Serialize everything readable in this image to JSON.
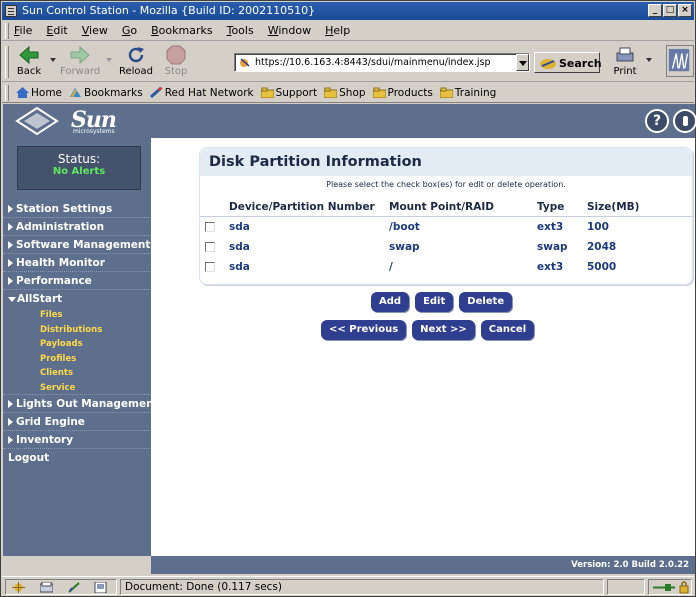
{
  "window": {
    "title": "Sun Control Station - Mozilla {Build ID: 2002110510}"
  },
  "menubar": {
    "items": [
      "File",
      "Edit",
      "View",
      "Go",
      "Bookmarks",
      "Tools",
      "Window",
      "Help"
    ]
  },
  "navbar": {
    "back": "Back",
    "forward": "Forward",
    "reload": "Reload",
    "stop": "Stop",
    "url": "https://10.6.163.4:8443/sdui/mainmenu/index.jsp",
    "search": "Search",
    "print": "Print"
  },
  "personal_toolbar": {
    "items": [
      "Home",
      "Bookmarks",
      "Red Hat Network",
      "Support",
      "Shop",
      "Products",
      "Training"
    ]
  },
  "header": {
    "brand": "Sun",
    "brand_sub": "microsystems",
    "help_label": "?"
  },
  "sidebar": {
    "status_title": "Status:",
    "status_value": "No Alerts",
    "items_top": [
      "Station Settings",
      "Administration",
      "Software Management",
      "Health Monitor",
      "Performance"
    ],
    "allstart_label": "AllStart",
    "allstart_sub": [
      "Files",
      "Distributions",
      "Payloads",
      "Profiles",
      "Clients",
      "Service"
    ],
    "items_bottom": [
      "Lights Out Management",
      "Grid Engine",
      "Inventory"
    ],
    "logout": "Logout"
  },
  "panel": {
    "title": "Disk Partition Information",
    "hint": "Please select the check box(es) for edit or delete operation.",
    "columns": [
      "Device/Partition Number",
      "Mount Point/RAID",
      "Type",
      "Size(MB)"
    ],
    "rows": [
      {
        "device": "sda",
        "mount": "/boot",
        "type": "ext3",
        "size": "100"
      },
      {
        "device": "sda",
        "mount": "swap",
        "type": "swap",
        "size": "2048"
      },
      {
        "device": "sda",
        "mount": "/",
        "type": "ext3",
        "size": "5000"
      }
    ]
  },
  "actions": {
    "add": "Add",
    "edit": "Edit",
    "delete": "Delete",
    "previous": "<< Previous",
    "next": "Next >>",
    "cancel": "Cancel"
  },
  "footer": {
    "version": "Version: 2.0 Build 2.0.22"
  },
  "statusbar": {
    "text": "Document: Done (0.117 secs)"
  },
  "colors": {
    "sidebar_bg": "#5d6f8c",
    "status_ok": "#5ee85e",
    "submenu_text": "#ffd84a",
    "button_bg": "#2f3e8f",
    "link_text": "#1d3a7a"
  }
}
